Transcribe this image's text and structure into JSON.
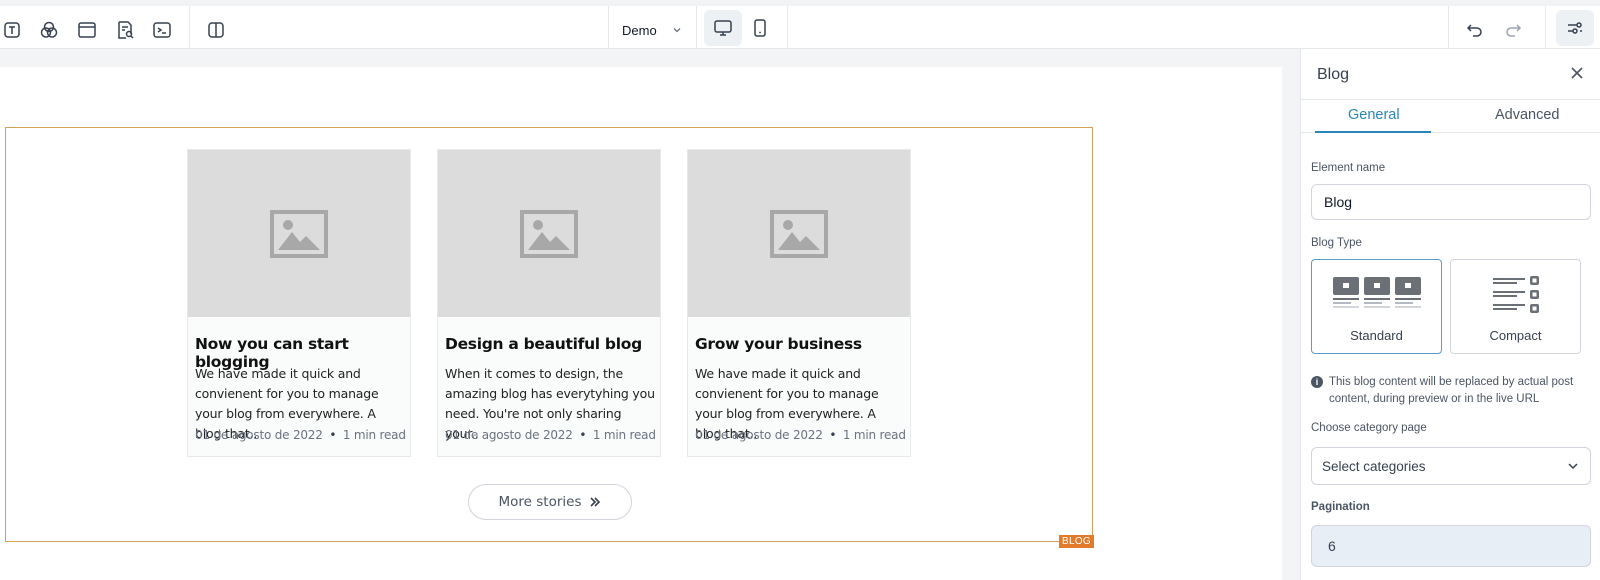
{
  "toolbar": {
    "left_icons": [
      "text-icon",
      "layers-icon",
      "window-icon",
      "page-search-icon",
      "terminal-icon",
      "columns-icon"
    ],
    "page_select": "Demo",
    "devices": [
      "desktop-icon",
      "mobile-icon"
    ],
    "undo": "undo-icon",
    "redo": "redo-icon",
    "settings": "sliders-icon"
  },
  "canvas": {
    "element_tag": "BLOG",
    "cards": [
      {
        "title": "Now you can start blogging",
        "desc": "We have made it quick and convienent for you to manage your blog from everywhere. A blog that..",
        "date": "01 de agosto de 2022",
        "read": "1 min read"
      },
      {
        "title": "Design a beautiful blog",
        "desc": "When it comes to design, the amazing blog has everytyhing you need. You're not only sharing your..",
        "date": "01 de agosto de 2022",
        "read": "1 min read"
      },
      {
        "title": "Grow your business",
        "desc": "We have made it quick and convienent for you to manage your blog from everywhere. A blog that..",
        "date": "01 de agosto de 2022",
        "read": "1 min read"
      }
    ],
    "more_button": "More stories",
    "dot": "•"
  },
  "panel": {
    "title": "Blog",
    "tabs": [
      "General",
      "Advanced"
    ],
    "element_name_label": "Element name",
    "element_name_value": "Blog",
    "blog_type_label": "Blog Type",
    "blog_types": [
      "Standard",
      "Compact"
    ],
    "info": "This blog content will be replaced by actual post content, during preview or in the live URL",
    "category_label": "Choose category page",
    "category_placeholder": "Select categories",
    "pagination_label": "Pagination",
    "pagination_value": "6"
  },
  "colors": {
    "accent": "#2a86b8",
    "frame": "#d4a25a",
    "tag": "#e47b2b"
  }
}
